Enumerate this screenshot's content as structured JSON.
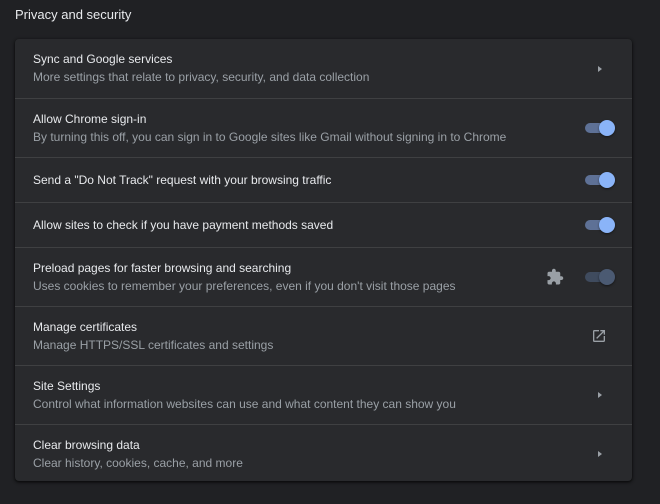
{
  "section": {
    "title": "Privacy and security"
  },
  "rows": [
    {
      "primary": "Sync and Google services",
      "secondary": "More settings that relate to privacy, security, and data collection",
      "control": "arrow"
    },
    {
      "primary": "Allow Chrome sign-in",
      "secondary": "By turning this off, you can sign in to Google sites like Gmail without signing in to Chrome",
      "control": "toggle",
      "checked": true
    },
    {
      "primary": "Send a \"Do Not Track\" request with your browsing traffic",
      "control": "toggle",
      "checked": true
    },
    {
      "primary": "Allow sites to check if you have payment methods saved",
      "control": "toggle",
      "checked": true
    },
    {
      "primary": "Preload pages for faster browsing and searching",
      "secondary": "Uses cookies to remember your preferences, even if you don't visit those pages",
      "control": "toggle",
      "checked": true,
      "disabled": true,
      "extra_icon": "extension-puzzle-icon"
    },
    {
      "primary": "Manage certificates",
      "secondary": "Manage HTTPS/SSL certificates and settings",
      "control": "external-link-icon"
    },
    {
      "primary": "Site Settings",
      "secondary": "Control what information websites can use and what content they can show you",
      "control": "arrow"
    },
    {
      "primary": "Clear browsing data",
      "secondary": "Clear history, cookies, cache, and more",
      "control": "arrow"
    }
  ],
  "colors": {
    "background": "#202124",
    "card": "#292a2d",
    "primary_text": "#e8eaed",
    "secondary_text": "#9aa0a6",
    "toggle_knob": "#8ab4f8",
    "toggle_track": "#5e7196",
    "divider": "#3f4042"
  }
}
